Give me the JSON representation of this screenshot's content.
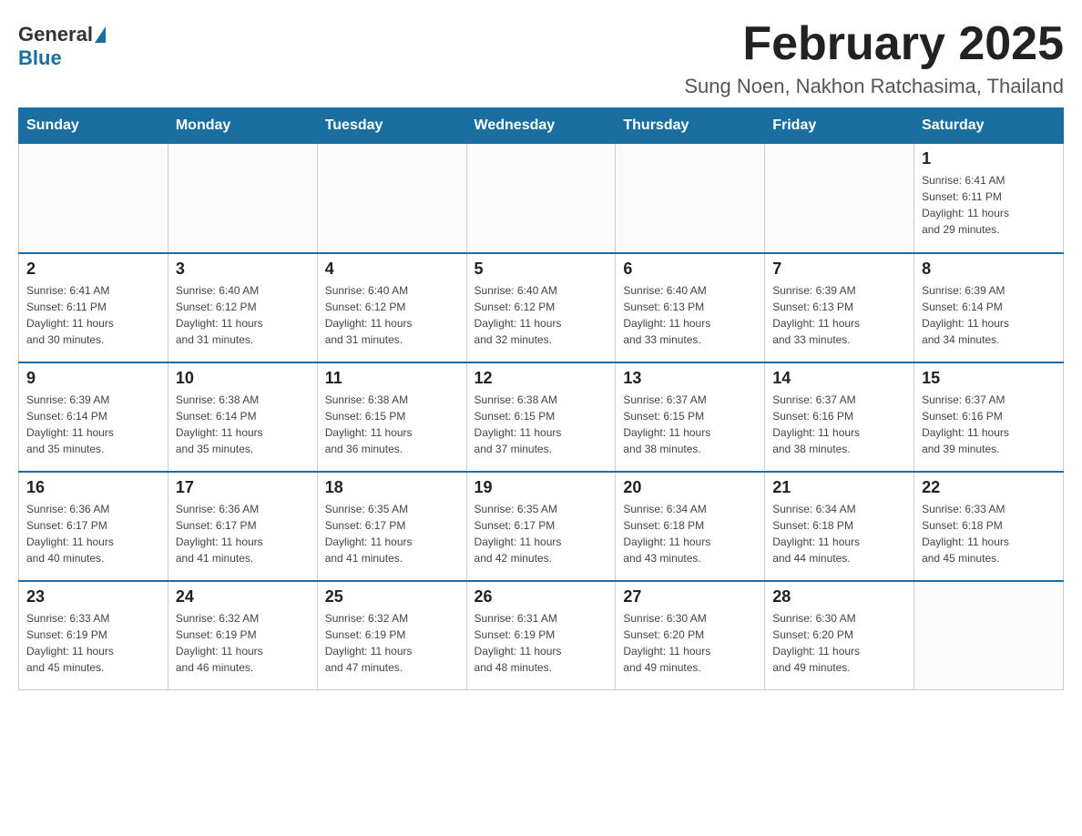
{
  "header": {
    "logo_general": "General",
    "logo_blue": "Blue",
    "title": "February 2025",
    "subtitle": "Sung Noen, Nakhon Ratchasima, Thailand"
  },
  "weekdays": [
    "Sunday",
    "Monday",
    "Tuesday",
    "Wednesday",
    "Thursday",
    "Friday",
    "Saturday"
  ],
  "weeks": [
    [
      {
        "day": "",
        "info": ""
      },
      {
        "day": "",
        "info": ""
      },
      {
        "day": "",
        "info": ""
      },
      {
        "day": "",
        "info": ""
      },
      {
        "day": "",
        "info": ""
      },
      {
        "day": "",
        "info": ""
      },
      {
        "day": "1",
        "info": "Sunrise: 6:41 AM\nSunset: 6:11 PM\nDaylight: 11 hours\nand 29 minutes."
      }
    ],
    [
      {
        "day": "2",
        "info": "Sunrise: 6:41 AM\nSunset: 6:11 PM\nDaylight: 11 hours\nand 30 minutes."
      },
      {
        "day": "3",
        "info": "Sunrise: 6:40 AM\nSunset: 6:12 PM\nDaylight: 11 hours\nand 31 minutes."
      },
      {
        "day": "4",
        "info": "Sunrise: 6:40 AM\nSunset: 6:12 PM\nDaylight: 11 hours\nand 31 minutes."
      },
      {
        "day": "5",
        "info": "Sunrise: 6:40 AM\nSunset: 6:12 PM\nDaylight: 11 hours\nand 32 minutes."
      },
      {
        "day": "6",
        "info": "Sunrise: 6:40 AM\nSunset: 6:13 PM\nDaylight: 11 hours\nand 33 minutes."
      },
      {
        "day": "7",
        "info": "Sunrise: 6:39 AM\nSunset: 6:13 PM\nDaylight: 11 hours\nand 33 minutes."
      },
      {
        "day": "8",
        "info": "Sunrise: 6:39 AM\nSunset: 6:14 PM\nDaylight: 11 hours\nand 34 minutes."
      }
    ],
    [
      {
        "day": "9",
        "info": "Sunrise: 6:39 AM\nSunset: 6:14 PM\nDaylight: 11 hours\nand 35 minutes."
      },
      {
        "day": "10",
        "info": "Sunrise: 6:38 AM\nSunset: 6:14 PM\nDaylight: 11 hours\nand 35 minutes."
      },
      {
        "day": "11",
        "info": "Sunrise: 6:38 AM\nSunset: 6:15 PM\nDaylight: 11 hours\nand 36 minutes."
      },
      {
        "day": "12",
        "info": "Sunrise: 6:38 AM\nSunset: 6:15 PM\nDaylight: 11 hours\nand 37 minutes."
      },
      {
        "day": "13",
        "info": "Sunrise: 6:37 AM\nSunset: 6:15 PM\nDaylight: 11 hours\nand 38 minutes."
      },
      {
        "day": "14",
        "info": "Sunrise: 6:37 AM\nSunset: 6:16 PM\nDaylight: 11 hours\nand 38 minutes."
      },
      {
        "day": "15",
        "info": "Sunrise: 6:37 AM\nSunset: 6:16 PM\nDaylight: 11 hours\nand 39 minutes."
      }
    ],
    [
      {
        "day": "16",
        "info": "Sunrise: 6:36 AM\nSunset: 6:17 PM\nDaylight: 11 hours\nand 40 minutes."
      },
      {
        "day": "17",
        "info": "Sunrise: 6:36 AM\nSunset: 6:17 PM\nDaylight: 11 hours\nand 41 minutes."
      },
      {
        "day": "18",
        "info": "Sunrise: 6:35 AM\nSunset: 6:17 PM\nDaylight: 11 hours\nand 41 minutes."
      },
      {
        "day": "19",
        "info": "Sunrise: 6:35 AM\nSunset: 6:17 PM\nDaylight: 11 hours\nand 42 minutes."
      },
      {
        "day": "20",
        "info": "Sunrise: 6:34 AM\nSunset: 6:18 PM\nDaylight: 11 hours\nand 43 minutes."
      },
      {
        "day": "21",
        "info": "Sunrise: 6:34 AM\nSunset: 6:18 PM\nDaylight: 11 hours\nand 44 minutes."
      },
      {
        "day": "22",
        "info": "Sunrise: 6:33 AM\nSunset: 6:18 PM\nDaylight: 11 hours\nand 45 minutes."
      }
    ],
    [
      {
        "day": "23",
        "info": "Sunrise: 6:33 AM\nSunset: 6:19 PM\nDaylight: 11 hours\nand 45 minutes."
      },
      {
        "day": "24",
        "info": "Sunrise: 6:32 AM\nSunset: 6:19 PM\nDaylight: 11 hours\nand 46 minutes."
      },
      {
        "day": "25",
        "info": "Sunrise: 6:32 AM\nSunset: 6:19 PM\nDaylight: 11 hours\nand 47 minutes."
      },
      {
        "day": "26",
        "info": "Sunrise: 6:31 AM\nSunset: 6:19 PM\nDaylight: 11 hours\nand 48 minutes."
      },
      {
        "day": "27",
        "info": "Sunrise: 6:30 AM\nSunset: 6:20 PM\nDaylight: 11 hours\nand 49 minutes."
      },
      {
        "day": "28",
        "info": "Sunrise: 6:30 AM\nSunset: 6:20 PM\nDaylight: 11 hours\nand 49 minutes."
      },
      {
        "day": "",
        "info": ""
      }
    ]
  ]
}
